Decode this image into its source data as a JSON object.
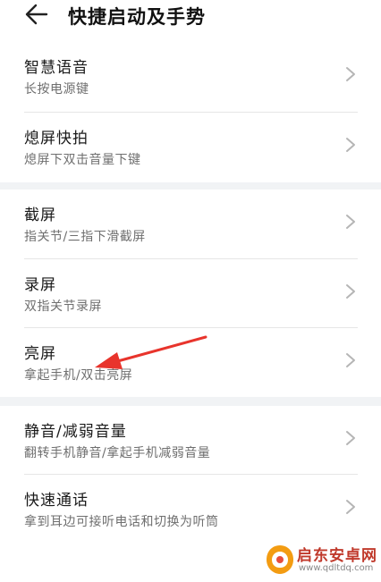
{
  "header": {
    "title": "快捷启动及手势",
    "back_icon": "back-arrow-icon"
  },
  "rows": [
    {
      "title": "智慧语音",
      "subtitle": "长按电源键"
    },
    {
      "title": "熄屏快拍",
      "subtitle": "熄屏下双击音量下键"
    },
    {
      "title": "截屏",
      "subtitle": "指关节/三指下滑截屏"
    },
    {
      "title": "录屏",
      "subtitle": "双指关节录屏"
    },
    {
      "title": "亮屏",
      "subtitle": "拿起手机/双击亮屏"
    },
    {
      "title": "静音/减弱音量",
      "subtitle": "翻转手机静音/拿起手机减弱音量"
    },
    {
      "title": "快速通话",
      "subtitle": "拿到耳边可接听电话和切换为听筒"
    }
  ],
  "annotation": {
    "color": "#e8342c"
  },
  "watermark": {
    "name": "启东安卓网",
    "url": "www.qdltdq.com",
    "color": "#c0392b"
  },
  "colors": {
    "background": "#ffffff",
    "section_gap": "#f1f3f5",
    "subtitle": "#6f6f6f",
    "chevron": "#b5b5b5"
  }
}
